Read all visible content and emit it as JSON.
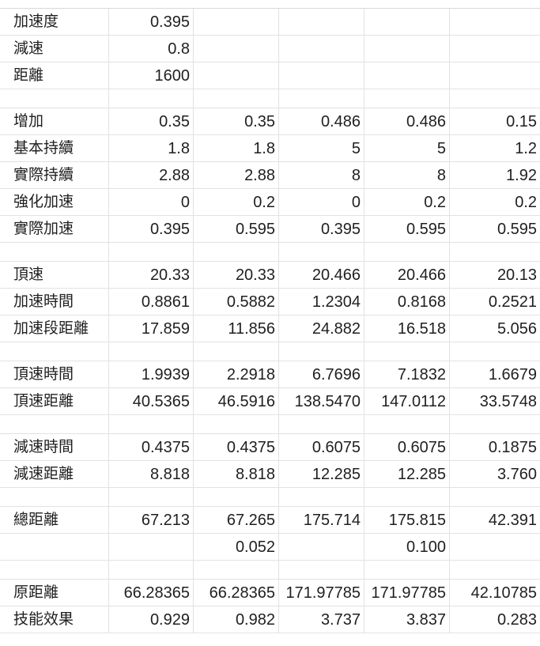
{
  "sheet": {
    "rows": [
      {
        "label": "加速度",
        "cells": [
          "0.395",
          "",
          "",
          "",
          ""
        ]
      },
      {
        "label": "減速",
        "cells": [
          "0.8",
          "",
          "",
          "",
          ""
        ]
      },
      {
        "label": "距離",
        "cells": [
          "1600",
          "",
          "",
          "",
          ""
        ]
      },
      {
        "label": "",
        "cells": [
          "",
          "",
          "",
          "",
          ""
        ]
      },
      {
        "label": "增加",
        "cells": [
          "0.35",
          "0.35",
          "0.486",
          "0.486",
          "0.15"
        ]
      },
      {
        "label": "基本持續",
        "cells": [
          "1.8",
          "1.8",
          "5",
          "5",
          "1.2"
        ]
      },
      {
        "label": "實際持續",
        "cells": [
          "2.88",
          "2.88",
          "8",
          "8",
          "1.92"
        ]
      },
      {
        "label": "強化加速",
        "cells": [
          "0",
          "0.2",
          "0",
          "0.2",
          "0.2"
        ]
      },
      {
        "label": "實際加速",
        "cells": [
          "0.395",
          "0.595",
          "0.395",
          "0.595",
          "0.595"
        ]
      },
      {
        "label": "",
        "cells": [
          "",
          "",
          "",
          "",
          ""
        ]
      },
      {
        "label": "頂速",
        "cells": [
          "20.33",
          "20.33",
          "20.466",
          "20.466",
          "20.13"
        ]
      },
      {
        "label": "加速時間",
        "cells": [
          "0.8861",
          "0.5882",
          "1.2304",
          "0.8168",
          "0.2521"
        ]
      },
      {
        "label": "加速段距離",
        "cells": [
          "17.859",
          "11.856",
          "24.882",
          "16.518",
          "5.056"
        ]
      },
      {
        "label": "",
        "cells": [
          "",
          "",
          "",
          "",
          ""
        ]
      },
      {
        "label": "頂速時間",
        "cells": [
          "1.9939",
          "2.2918",
          "6.7696",
          "7.1832",
          "1.6679"
        ]
      },
      {
        "label": "頂速距離",
        "cells": [
          "40.5365",
          "46.5916",
          "138.5470",
          "147.0112",
          "33.5748"
        ]
      },
      {
        "label": "",
        "cells": [
          "",
          "",
          "",
          "",
          ""
        ]
      },
      {
        "label": "減速時間",
        "cells": [
          "0.4375",
          "0.4375",
          "0.6075",
          "0.6075",
          "0.1875"
        ]
      },
      {
        "label": "減速距離",
        "cells": [
          "8.818",
          "8.818",
          "12.285",
          "12.285",
          "3.760"
        ]
      },
      {
        "label": "",
        "cells": [
          "",
          "",
          "",
          "",
          ""
        ]
      },
      {
        "label": "總距離",
        "cells": [
          "67.213",
          "67.265",
          "175.714",
          "175.815",
          "42.391"
        ]
      },
      {
        "label": "",
        "cells": [
          "",
          "0.052",
          "",
          "0.100",
          ""
        ]
      },
      {
        "label": "",
        "cells": [
          "",
          "",
          "",
          "",
          ""
        ]
      },
      {
        "label": "原距離",
        "cells": [
          "66.28365",
          "66.28365",
          "171.97785",
          "171.97785",
          "42.10785"
        ]
      },
      {
        "label": "技能效果",
        "cells": [
          "0.929",
          "0.982",
          "3.737",
          "3.837",
          "0.283"
        ]
      }
    ]
  }
}
